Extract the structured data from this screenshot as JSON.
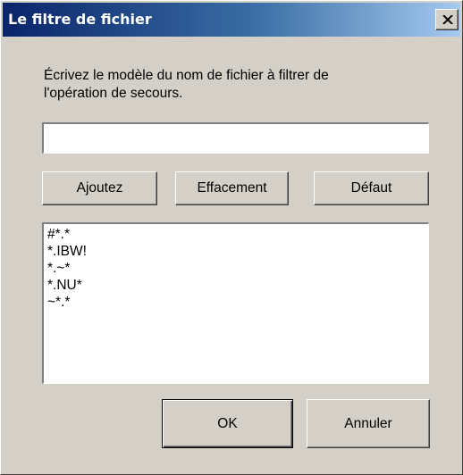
{
  "window": {
    "title": "Le filtre de fichier",
    "close_icon": "close-icon"
  },
  "instruction": {
    "line1": "Écrivez le modèle du nom de fichier à filtrer de",
    "line2": "l'opération de secours."
  },
  "filter_input": {
    "value": "",
    "placeholder": ""
  },
  "buttons": {
    "add": "Ajoutez",
    "clear": "Effacement",
    "default": "Défaut",
    "ok": "OK",
    "cancel": "Annuler"
  },
  "filter_list": {
    "items": [
      "#*.*",
      "*.IBW!",
      "*.~*",
      "*.NU*",
      "~*.*"
    ]
  },
  "colors": {
    "titlebar_start": "#0a246a",
    "titlebar_end": "#a6caf0",
    "face": "#d4d0c8"
  }
}
